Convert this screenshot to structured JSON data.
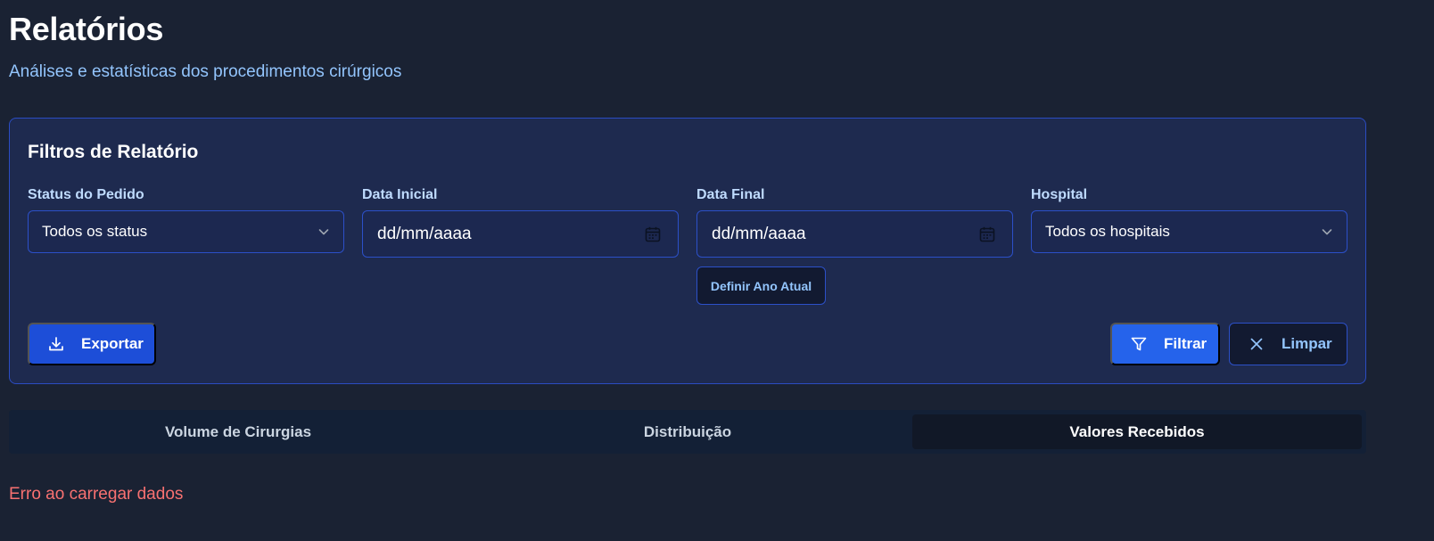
{
  "header": {
    "title": "Relatórios",
    "subtitle": "Análises e estatísticas dos procedimentos cirúrgicos"
  },
  "filters": {
    "title": "Filtros de Relatório",
    "status": {
      "label": "Status do Pedido",
      "value": "Todos os status"
    },
    "start_date": {
      "label": "Data Inicial",
      "placeholder": "dd/mm/aaaa"
    },
    "end_date": {
      "label": "Data Final",
      "placeholder": "dd/mm/aaaa"
    },
    "hospital": {
      "label": "Hospital",
      "value": "Todos os hospitais"
    },
    "set_year_label": "Definir Ano Atual",
    "export_label": "Exportar",
    "filter_label": "Filtrar",
    "clear_label": "Limpar"
  },
  "tabs": [
    {
      "label": "Volume de Cirurgias",
      "active": false
    },
    {
      "label": "Distribuição",
      "active": false
    },
    {
      "label": "Valores Recebidos",
      "active": true
    }
  ],
  "status_message": "Erro ao carregar dados",
  "colors": {
    "background": "#1a2233",
    "card": "#1e2a4f",
    "border": "#2b4cc2",
    "primary": "#2563eb",
    "accent_text": "#93c5fd",
    "error": "#f87171"
  },
  "icons": {
    "select": "chevron-down-icon",
    "date": "calendar-icon",
    "export": "download-icon",
    "filter": "filter-icon",
    "clear": "close-icon"
  }
}
